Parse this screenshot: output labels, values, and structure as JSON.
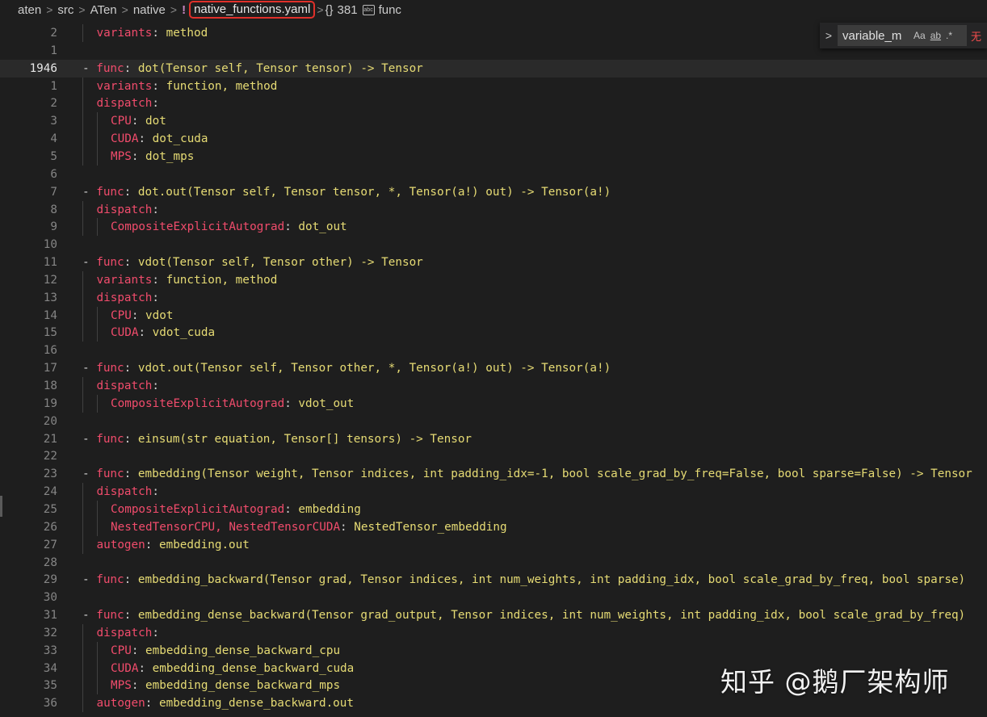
{
  "breadcrumb": {
    "items": [
      "aten",
      "src",
      "ATen",
      "native"
    ],
    "file_icon": "!",
    "file": "native_functions.yaml",
    "braces": "{}",
    "symbol_count": "381",
    "symbol": "func"
  },
  "find_widget": {
    "value": "variable_m",
    "match_case": "Aa",
    "whole_word": "ab",
    "regex": ".*",
    "extra": "无"
  },
  "watermark": "知乎 @鹅厂架构师",
  "lines": [
    {
      "n": "2",
      "t": [
        [
          "k",
          "variants"
        ],
        [
          "p",
          ": "
        ],
        [
          "v",
          "method"
        ]
      ]
    },
    {
      "n": "1",
      "t": []
    },
    {
      "n": "1946",
      "current": true,
      "t": [
        [
          "p",
          "- "
        ],
        [
          "k",
          "func"
        ],
        [
          "p",
          ": "
        ],
        [
          "v",
          "dot(Tensor self, Tensor tensor) -> Tensor"
        ]
      ]
    },
    {
      "n": "1",
      "t": [
        [
          "k",
          "variants"
        ],
        [
          "p",
          ": "
        ],
        [
          "v",
          "function, method"
        ]
      ]
    },
    {
      "n": "2",
      "t": [
        [
          "k",
          "dispatch"
        ],
        [
          "p",
          ":"
        ]
      ]
    },
    {
      "n": "3",
      "t": [
        [
          "k",
          "CPU"
        ],
        [
          "p",
          ": "
        ],
        [
          "v",
          "dot"
        ]
      ]
    },
    {
      "n": "4",
      "t": [
        [
          "k",
          "CUDA"
        ],
        [
          "p",
          ": "
        ],
        [
          "v",
          "dot_cuda"
        ]
      ]
    },
    {
      "n": "5",
      "t": [
        [
          "k",
          "MPS"
        ],
        [
          "p",
          ": "
        ],
        [
          "v",
          "dot_mps"
        ]
      ]
    },
    {
      "n": "6",
      "t": []
    },
    {
      "n": "7",
      "t": [
        [
          "p",
          "- "
        ],
        [
          "k",
          "func"
        ],
        [
          "p",
          ": "
        ],
        [
          "v",
          "dot.out(Tensor self, Tensor tensor, *, Tensor(a!) out) -> Tensor(a!)"
        ]
      ]
    },
    {
      "n": "8",
      "t": [
        [
          "k",
          "dispatch"
        ],
        [
          "p",
          ":"
        ]
      ]
    },
    {
      "n": "9",
      "t": [
        [
          "k",
          "CompositeExplicitAutograd"
        ],
        [
          "p",
          ": "
        ],
        [
          "v",
          "dot_out"
        ]
      ]
    },
    {
      "n": "10",
      "t": []
    },
    {
      "n": "11",
      "t": [
        [
          "p",
          "- "
        ],
        [
          "k",
          "func"
        ],
        [
          "p",
          ": "
        ],
        [
          "v",
          "vdot(Tensor self, Tensor other) -> Tensor"
        ]
      ]
    },
    {
      "n": "12",
      "t": [
        [
          "k",
          "variants"
        ],
        [
          "p",
          ": "
        ],
        [
          "v",
          "function, method"
        ]
      ]
    },
    {
      "n": "13",
      "t": [
        [
          "k",
          "dispatch"
        ],
        [
          "p",
          ":"
        ]
      ]
    },
    {
      "n": "14",
      "t": [
        [
          "k",
          "CPU"
        ],
        [
          "p",
          ": "
        ],
        [
          "v",
          "vdot"
        ]
      ]
    },
    {
      "n": "15",
      "t": [
        [
          "k",
          "CUDA"
        ],
        [
          "p",
          ": "
        ],
        [
          "v",
          "vdot_cuda"
        ]
      ]
    },
    {
      "n": "16",
      "t": []
    },
    {
      "n": "17",
      "t": [
        [
          "p",
          "- "
        ],
        [
          "k",
          "func"
        ],
        [
          "p",
          ": "
        ],
        [
          "v",
          "vdot.out(Tensor self, Tensor other, *, Tensor(a!) out) -> Tensor(a!)"
        ]
      ]
    },
    {
      "n": "18",
      "t": [
        [
          "k",
          "dispatch"
        ],
        [
          "p",
          ":"
        ]
      ]
    },
    {
      "n": "19",
      "t": [
        [
          "k",
          "CompositeExplicitAutograd"
        ],
        [
          "p",
          ": "
        ],
        [
          "v",
          "vdot_out"
        ]
      ]
    },
    {
      "n": "20",
      "t": []
    },
    {
      "n": "21",
      "t": [
        [
          "p",
          "- "
        ],
        [
          "k",
          "func"
        ],
        [
          "p",
          ": "
        ],
        [
          "v",
          "einsum(str equation, Tensor[] tensors) -> Tensor"
        ]
      ]
    },
    {
      "n": "22",
      "t": []
    },
    {
      "n": "23",
      "t": [
        [
          "p",
          "- "
        ],
        [
          "k",
          "func"
        ],
        [
          "p",
          ": "
        ],
        [
          "v",
          "embedding(Tensor weight, Tensor indices, int padding_idx=-1, bool scale_grad_by_freq=False, bool sparse=False) -> Tensor"
        ]
      ]
    },
    {
      "n": "24",
      "t": [
        [
          "k",
          "dispatch"
        ],
        [
          "p",
          ":"
        ]
      ]
    },
    {
      "n": "25",
      "t": [
        [
          "k",
          "CompositeExplicitAutograd"
        ],
        [
          "p",
          ": "
        ],
        [
          "v",
          "embedding"
        ]
      ]
    },
    {
      "n": "26",
      "t": [
        [
          "k",
          "NestedTensorCPU, NestedTensorCUDA"
        ],
        [
          "p",
          ": "
        ],
        [
          "v",
          "NestedTensor_embedding"
        ]
      ]
    },
    {
      "n": "27",
      "t": [
        [
          "k",
          "autogen"
        ],
        [
          "p",
          ": "
        ],
        [
          "v",
          "embedding.out"
        ]
      ]
    },
    {
      "n": "28",
      "t": []
    },
    {
      "n": "29",
      "t": [
        [
          "p",
          "- "
        ],
        [
          "k",
          "func"
        ],
        [
          "p",
          ": "
        ],
        [
          "v",
          "embedding_backward(Tensor grad, Tensor indices, int num_weights, int padding_idx, bool scale_grad_by_freq, bool sparse)"
        ]
      ]
    },
    {
      "n": "30",
      "t": []
    },
    {
      "n": "31",
      "t": [
        [
          "p",
          "- "
        ],
        [
          "k",
          "func"
        ],
        [
          "p",
          ": "
        ],
        [
          "v",
          "embedding_dense_backward(Tensor grad_output, Tensor indices, int num_weights, int padding_idx, bool scale_grad_by_freq)"
        ]
      ]
    },
    {
      "n": "32",
      "t": [
        [
          "k",
          "dispatch"
        ],
        [
          "p",
          ":"
        ]
      ]
    },
    {
      "n": "33",
      "t": [
        [
          "k",
          "CPU"
        ],
        [
          "p",
          ": "
        ],
        [
          "v",
          "embedding_dense_backward_cpu"
        ]
      ]
    },
    {
      "n": "34",
      "t": [
        [
          "k",
          "CUDA"
        ],
        [
          "p",
          ": "
        ],
        [
          "v",
          "embedding_dense_backward_cuda"
        ]
      ]
    },
    {
      "n": "35",
      "t": [
        [
          "k",
          "MPS"
        ],
        [
          "p",
          ": "
        ],
        [
          "v",
          "embedding_dense_backward_mps"
        ]
      ]
    },
    {
      "n": "36",
      "t": [
        [
          "k",
          "autogen"
        ],
        [
          "p",
          ": "
        ],
        [
          "v",
          "embedding_dense_backward.out"
        ]
      ]
    }
  ]
}
